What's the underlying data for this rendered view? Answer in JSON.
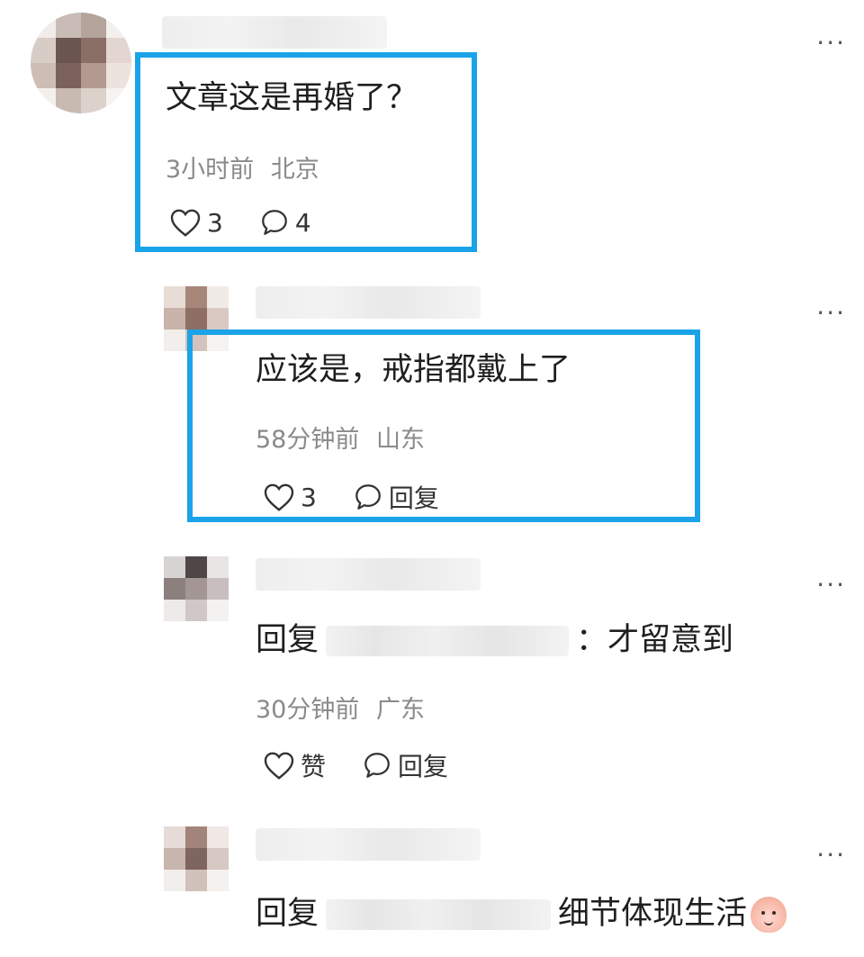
{
  "comments": [
    {
      "text": "文章这是再婚了？",
      "time": "3小时前",
      "location": "北京",
      "likes": "3",
      "replies": "4"
    },
    {
      "text": "应该是，戒指都戴上了",
      "time": "58分钟前",
      "location": "山东",
      "likes": "3",
      "reply_label": "回复"
    },
    {
      "reply_prefix": "回复",
      "text": "：才留意到",
      "time": "30分钟前",
      "location": "广东",
      "like_label": "赞",
      "reply_label": "回复"
    },
    {
      "reply_prefix": "回复",
      "text": "细节体现生活"
    }
  ],
  "more_label": "···",
  "icons": [
    "heart-icon",
    "comment-bubble-icon",
    "more-icon",
    "emoji-icon"
  ],
  "colors": {
    "highlight": "#1aa3e8",
    "meta_text": "#8a8a8a",
    "main_text": "#1f1f1f"
  }
}
